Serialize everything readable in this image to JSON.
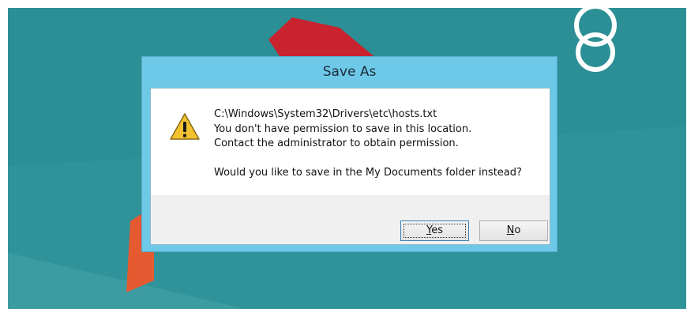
{
  "dialog": {
    "title": "Save As",
    "message": {
      "path": "C:\\Windows\\System32\\Drivers\\etc\\hosts.txt",
      "line1": "You don't have permission to save in this location.",
      "line2": "Contact the administrator to obtain permission.",
      "question": "Would you like to save in the My Documents folder instead?"
    },
    "buttons": {
      "yes_mnemonic": "Y",
      "yes_rest": "es",
      "no_mnemonic": "N",
      "no_rest": "o"
    }
  },
  "colors": {
    "desktop": "#2b8f95",
    "dialog_frame": "#6ec9e8",
    "warning_fill": "#f2c230",
    "shape_red": "#c8232e",
    "shape_orange": "#e55a30"
  },
  "icons": [
    "warning-icon"
  ]
}
